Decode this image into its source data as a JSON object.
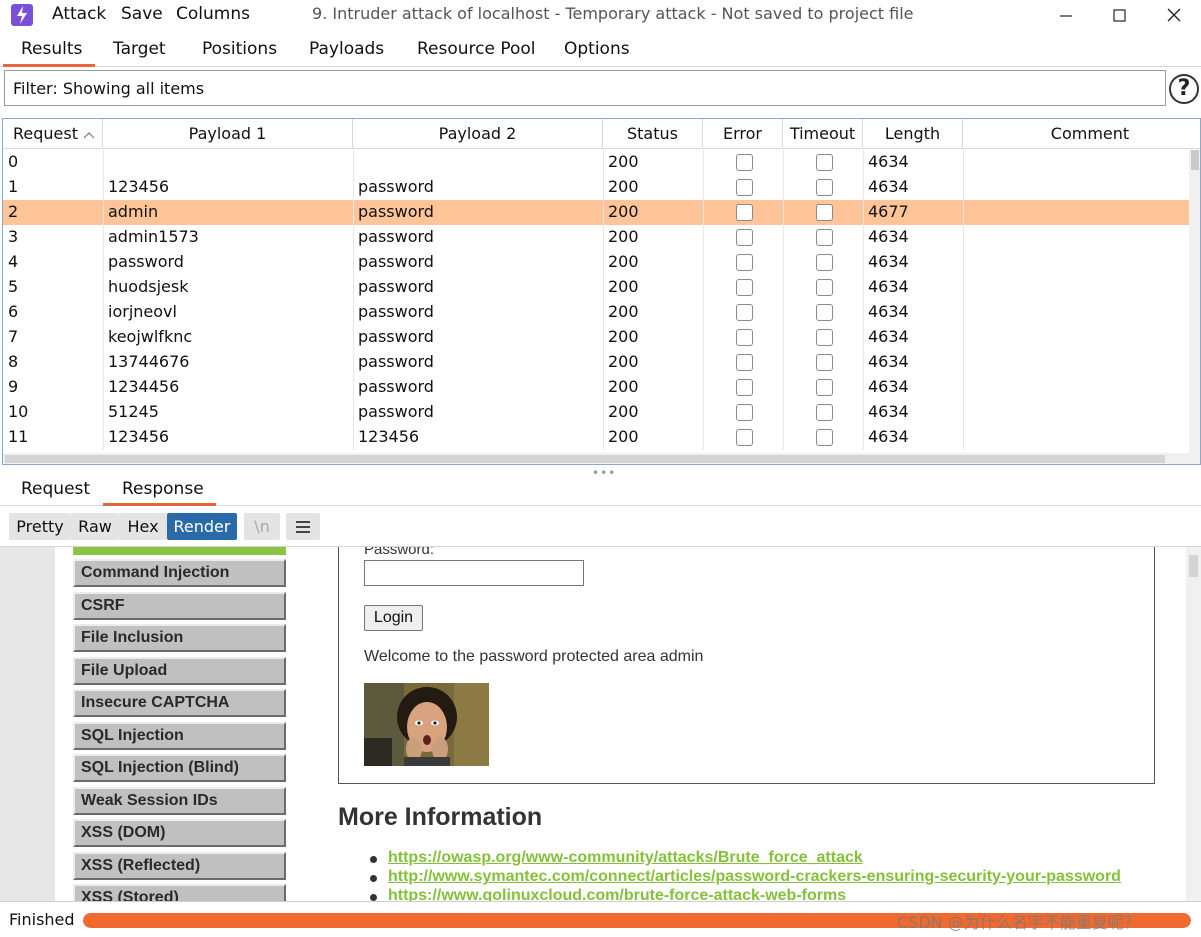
{
  "menu": {
    "attack": "Attack",
    "save": "Save",
    "columns": "Columns"
  },
  "window_title": "9. Intruder attack of localhost - Temporary attack - Not saved to project file",
  "main_tabs": [
    "Results",
    "Target",
    "Positions",
    "Payloads",
    "Resource Pool",
    "Options"
  ],
  "filter_text": "Filter: Showing all items",
  "help_label": "?",
  "table": {
    "headers": [
      "Request",
      "Payload 1",
      "Payload 2",
      "Status",
      "Error",
      "Timeout",
      "Length",
      "Comment"
    ],
    "rows": [
      {
        "request": "0",
        "payload1": "",
        "payload2": "",
        "status": "200",
        "length": "4634"
      },
      {
        "request": "1",
        "payload1": "123456",
        "payload2": "password",
        "status": "200",
        "length": "4634"
      },
      {
        "request": "2",
        "payload1": "admin",
        "payload2": "password",
        "status": "200",
        "length": "4677",
        "selected": true
      },
      {
        "request": "3",
        "payload1": "admin1573",
        "payload2": "password",
        "status": "200",
        "length": "4634"
      },
      {
        "request": "4",
        "payload1": "password",
        "payload2": "password",
        "status": "200",
        "length": "4634"
      },
      {
        "request": "5",
        "payload1": "huodsjesk",
        "payload2": "password",
        "status": "200",
        "length": "4634"
      },
      {
        "request": "6",
        "payload1": "iorjneovl",
        "payload2": "password",
        "status": "200",
        "length": "4634"
      },
      {
        "request": "7",
        "payload1": "keojwlfknc",
        "payload2": "password",
        "status": "200",
        "length": "4634"
      },
      {
        "request": "8",
        "payload1": "13744676",
        "payload2": "password",
        "status": "200",
        "length": "4634"
      },
      {
        "request": "9",
        "payload1": "1234456",
        "payload2": "password",
        "status": "200",
        "length": "4634"
      },
      {
        "request": "10",
        "payload1": "51245",
        "payload2": "password",
        "status": "200",
        "length": "4634"
      },
      {
        "request": "11",
        "payload1": "123456",
        "payload2": "123456",
        "status": "200",
        "length": "4634"
      }
    ]
  },
  "sub_tabs": [
    "Request",
    "Response"
  ],
  "view_buttons": {
    "pretty": "Pretty",
    "raw": "Raw",
    "hex": "Hex",
    "render": "Render",
    "newline": "\\n"
  },
  "render": {
    "nav_items": [
      "Command Injection",
      "CSRF",
      "File Inclusion",
      "File Upload",
      "Insecure CAPTCHA",
      "SQL Injection",
      "SQL Injection (Blind)",
      "Weak Session IDs",
      "XSS (DOM)",
      "XSS (Reflected)",
      "XSS (Stored)"
    ],
    "password_label": "Password:",
    "login_button": "Login",
    "welcome": "Welcome to the password protected area admin",
    "more_heading": "More Information",
    "links": [
      "https://owasp.org/www-community/attacks/Brute_force_attack",
      "http://www.symantec.com/connect/articles/password-crackers-ensuring-security-your-password",
      "https://www.golinuxcloud.com/brute-force-attack-web-forms"
    ]
  },
  "status": {
    "text": "Finished",
    "progress": 1.0,
    "watermark": "CSDN @为什么名字不能重复呢？"
  },
  "colors": {
    "accent": "#e8643a",
    "selected_row": "#ffc598",
    "render_active": "#2a6aa8",
    "link_green": "#84c13a",
    "progress": "#f06a2f"
  }
}
